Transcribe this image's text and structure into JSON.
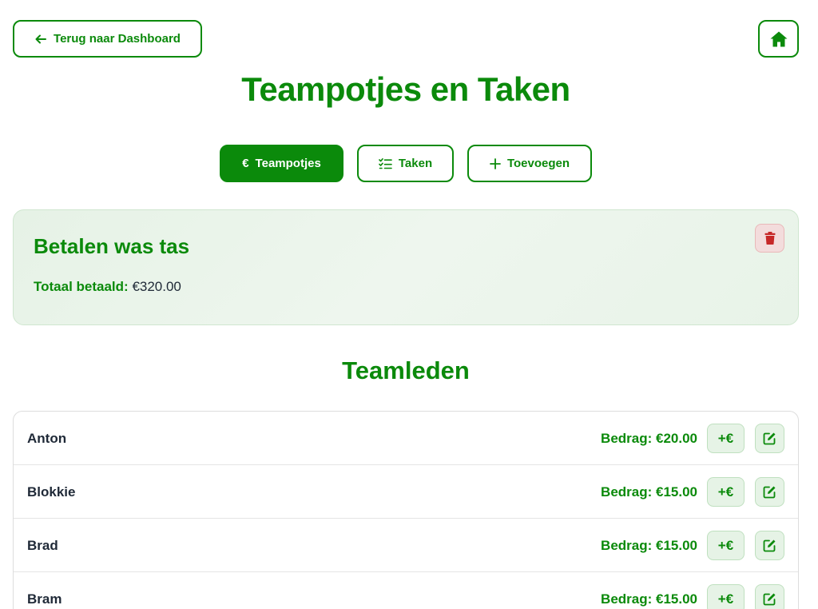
{
  "header": {
    "back_label": "Terug naar Dashboard",
    "back_icon": "arrow-left-icon",
    "home_icon": "home-icon"
  },
  "page_title": "Teampotjes en Taken",
  "tabs": [
    {
      "label": "Teampotjes",
      "icon": "euro-icon",
      "active": true
    },
    {
      "label": "Taken",
      "icon": "checklist-icon",
      "active": false
    },
    {
      "label": "Toevoegen",
      "icon": "plus-icon",
      "active": false
    }
  ],
  "pot": {
    "title": "Betalen was tas",
    "total_label": "Totaal betaald:",
    "total_value": "€320.00",
    "delete_icon": "trash-icon"
  },
  "members_title": "Teamleden",
  "members": [
    {
      "name": "Anton",
      "amount": "Bedrag: €20.00",
      "add_label": "+€"
    },
    {
      "name": "Blokkie",
      "amount": "Bedrag: €15.00",
      "add_label": "+€"
    },
    {
      "name": "Brad",
      "amount": "Bedrag: €15.00",
      "add_label": "+€"
    },
    {
      "name": "Bram",
      "amount": "Bedrag: €15.00",
      "add_label": "+€"
    }
  ],
  "colors": {
    "primary": "#0b8a0b",
    "danger": "#c62828",
    "card_bg": "#eaf4ea"
  }
}
